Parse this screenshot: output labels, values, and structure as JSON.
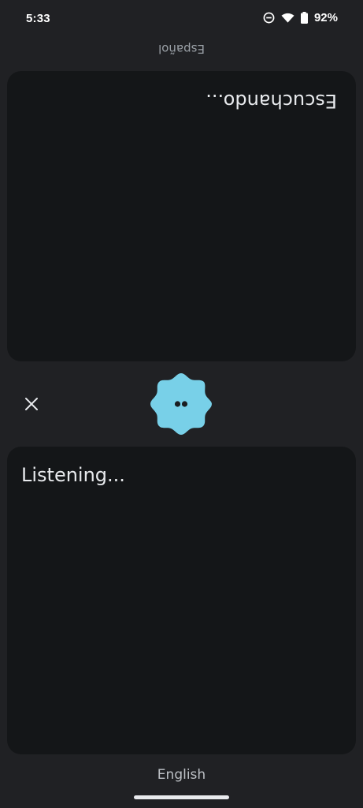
{
  "status_bar": {
    "time": "5:33",
    "battery": "92%",
    "icons": [
      "do-not-disturb-icon",
      "wifi-icon",
      "battery-icon"
    ]
  },
  "top": {
    "language_label": "Español",
    "panel_text": "Escuchando..."
  },
  "bottom": {
    "language_label": "English",
    "panel_text": "Listening..."
  },
  "controls": {
    "close_icon": "close-icon",
    "mic_icon": "listening-blob-icon"
  },
  "colors": {
    "background": "#202124",
    "panel": "#141618",
    "accent": "#78d0e8"
  }
}
